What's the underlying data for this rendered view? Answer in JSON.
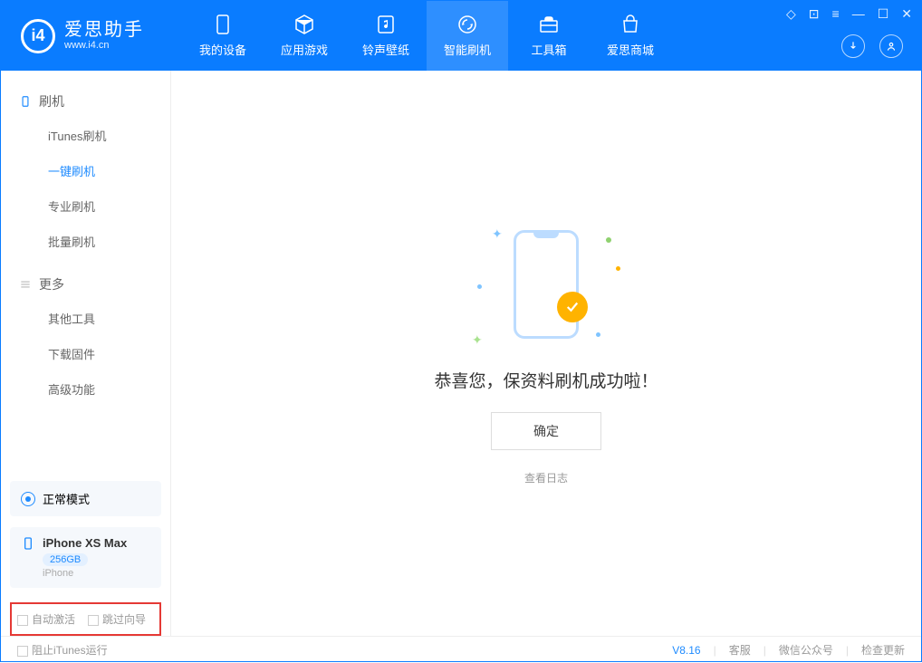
{
  "app": {
    "title": "爱思助手",
    "site": "www.i4.cn"
  },
  "nav": {
    "device": "我的设备",
    "apps": "应用游戏",
    "ringtone": "铃声壁纸",
    "flash": "智能刷机",
    "toolbox": "工具箱",
    "store": "爱思商城"
  },
  "sidebar": {
    "group_flash": "刷机",
    "items_flash": {
      "itunes": "iTunes刷机",
      "onekey": "一键刷机",
      "pro": "专业刷机",
      "batch": "批量刷机"
    },
    "group_more": "更多",
    "items_more": {
      "other": "其他工具",
      "firmware": "下载固件",
      "advanced": "高级功能"
    }
  },
  "mode_label": "正常模式",
  "device": {
    "name": "iPhone XS Max",
    "storage": "256GB",
    "type": "iPhone"
  },
  "options": {
    "auto_activate": "自动激活",
    "skip_guide": "跳过向导"
  },
  "main": {
    "success": "恭喜您，保资料刷机成功啦！",
    "ok": "确定",
    "view_log": "查看日志"
  },
  "status": {
    "block_itunes": "阻止iTunes运行",
    "version": "V8.16",
    "cs": "客服",
    "wechat": "微信公众号",
    "update": "检查更新"
  }
}
